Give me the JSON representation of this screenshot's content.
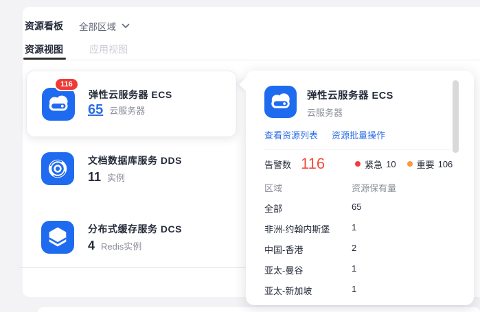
{
  "header": {
    "title": "资源看板",
    "region_selector": "全部区域",
    "tabs": [
      {
        "label": "资源视图",
        "active": true
      },
      {
        "label": "应用视图",
        "active": false
      }
    ]
  },
  "cards": [
    {
      "title": "弹性云服务器 ECS",
      "badge": "116",
      "count": "65",
      "unit": "云服务器",
      "icon": "ecs-cloud-server-icon"
    },
    {
      "title": "文档数据库服务 DDS",
      "count": "11",
      "unit": "实例",
      "icon": "dds-swirl-icon"
    },
    {
      "title": "分布式缓存服务 DCS",
      "count": "4",
      "unit": "Redis实例",
      "icon": "dcs-hexagon-icon"
    }
  ],
  "popup": {
    "title": "弹性云服务器 ECS",
    "subtitle": "云服务器",
    "links": [
      "查看资源列表",
      "资源批量操作"
    ],
    "alarm": {
      "label": "告警数",
      "value": "116",
      "severities": [
        {
          "label": "紧急",
          "count": "10",
          "color": "#f23d3d"
        },
        {
          "label": "重要",
          "count": "106",
          "color": "#fa9841"
        }
      ]
    },
    "table": {
      "headers": [
        "区域",
        "资源保有量"
      ],
      "rows": [
        [
          "全部",
          "65"
        ],
        [
          "非洲-约翰内斯堡",
          "1"
        ],
        [
          "中国-香港",
          "2"
        ],
        [
          "亚太-曼谷",
          "1"
        ],
        [
          "亚太-新加坡",
          "1"
        ]
      ]
    }
  },
  "colors": {
    "icon_blue": "#1f6bf0",
    "link_blue": "#2b6de5",
    "badge_red": "#ee3b35",
    "alarm_red": "#f34b3b",
    "critical_dot": "#f23d3d",
    "major_dot": "#fa9841"
  }
}
